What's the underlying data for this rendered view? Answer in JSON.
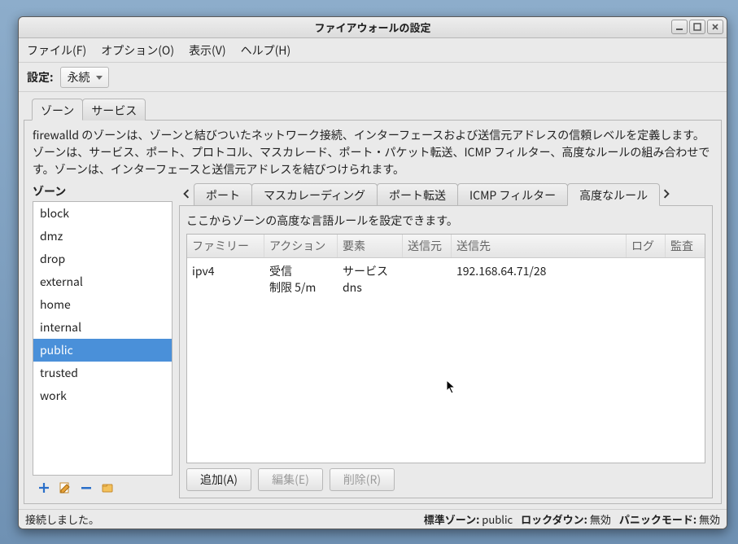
{
  "window": {
    "title": "ファイアウォールの設定"
  },
  "menubar": {
    "file": "ファイル(F)",
    "options": "オプション(O)",
    "view": "表示(V)",
    "help": "ヘルプ(H)"
  },
  "config": {
    "label": "設定:",
    "value": "永続"
  },
  "outer_tabs": {
    "zone": "ゾーン",
    "service": "サービス"
  },
  "description": "firewalld のゾーンは、ゾーンと結びついたネットワーク接続、インターフェースおよび送信元アドレスの信頼レベルを定義します。ゾーンは、サービス、ポート、プロトコル、マスカレード、ポート・パケット転送、ICMP フィルター、高度なルールの組み合わせです。ゾーンは、インターフェースと送信元アドレスを結びつけられます。",
  "zone_section_label": "ゾーン",
  "zones": [
    "block",
    "dmz",
    "drop",
    "external",
    "home",
    "internal",
    "public",
    "trusted",
    "work"
  ],
  "zone_selected_index": 6,
  "inner_tabs": {
    "ports": "ポート",
    "masq": "マスカレーディング",
    "pfwd": "ポート転送",
    "icmp": "ICMP フィルター",
    "rich": "高度なルール"
  },
  "inner_desc": "ここからゾーンの高度な言語ルールを設定できます。",
  "columns": {
    "family": "ファミリー",
    "action": "アクション",
    "element": "要素",
    "src": "送信元",
    "dst": "送信先",
    "log": "ログ",
    "audit": "監査"
  },
  "rules": [
    {
      "family": "ipv4",
      "action1": "受信",
      "action2": "制限 5/m",
      "element1": "サービス",
      "element2": "dns",
      "src": "",
      "dst": "192.168.64.71/28",
      "log": "",
      "audit": ""
    }
  ],
  "buttons": {
    "add": "追加(A)",
    "edit": "編集(E)",
    "delete": "削除(R)"
  },
  "status": {
    "connected": "接続しました。",
    "defzone_label": "標準ゾーン:",
    "defzone_value": "public",
    "lockdown_label": "ロックダウン:",
    "lockdown_value": "無効",
    "panic_label": "パニックモード:",
    "panic_value": "無効"
  }
}
